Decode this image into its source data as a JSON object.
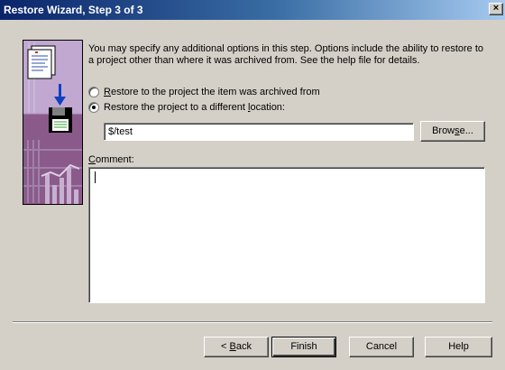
{
  "window": {
    "title": "Restore Wizard, Step 3 of 3",
    "close_glyph": "×"
  },
  "description": "You may specify any additional options in this step.  Options include the ability to restore to a project other than where it was archived from.  See the help file for details.",
  "options": [
    {
      "pre": "",
      "accel": "R",
      "post": "estore to the project the item was archived from",
      "checked": false
    },
    {
      "pre": "Restore the project to a different ",
      "accel": "l",
      "post": "ocation:",
      "checked": true
    }
  ],
  "location": {
    "value": "$/test"
  },
  "browse": {
    "pre": "Brow",
    "accel": "s",
    "post": "e..."
  },
  "comment": {
    "accel": "C",
    "post": "omment:",
    "value": ""
  },
  "buttons": {
    "back": {
      "pre": "< ",
      "accel": "B",
      "post": "ack"
    },
    "finish": "Finish",
    "cancel": "Cancel",
    "help": "Help"
  }
}
